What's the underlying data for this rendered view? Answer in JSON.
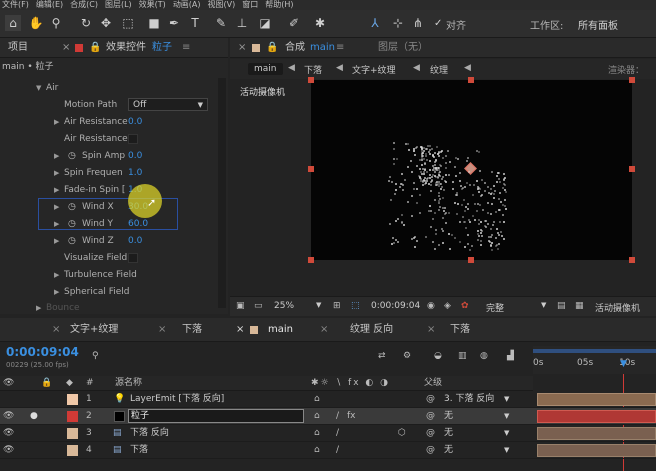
{
  "menu": [
    "文件(F)",
    "编辑(E)",
    "合成(C)",
    "图层(L)",
    "效果(T)",
    "动画(A)",
    "视图(V)",
    "窗口",
    "帮助(H)"
  ],
  "toolbar": {
    "align_label": "对齐",
    "workspace_label": "工作区:",
    "workspace_value": "所有面板"
  },
  "left_panel": {
    "tab_project": "项目",
    "tab_effects": "效果控件",
    "tab_effects_layer": "粒子",
    "breadcrumb": "main • 粒子",
    "air_group": "Air",
    "motion_path_label": "Motion Path",
    "motion_path_value": "Off",
    "props": [
      {
        "label": "Air Resistance",
        "value": "0.0"
      },
      {
        "label": "Air Resistance",
        "value": ""
      },
      {
        "label": "Spin Amp",
        "value": "0.0"
      },
      {
        "label": "Spin Frequen",
        "value": "1.0"
      },
      {
        "label": "Fade-in Spin [",
        "value": "1.0"
      },
      {
        "label": "Wind X",
        "value": "30.0"
      },
      {
        "label": "Wind Y",
        "value": "60.0"
      },
      {
        "label": "Wind Z",
        "value": "0.0"
      },
      {
        "label": "Visualize Field",
        "value": ""
      },
      {
        "label": "Turbulence Field",
        "value": ""
      },
      {
        "label": "Spherical Field",
        "value": ""
      },
      {
        "label": "Bounce",
        "value": ""
      }
    ]
  },
  "viewer": {
    "tab_comp_prefix": "合成",
    "tab_comp_name": "main",
    "tab_layer": "图层（无）",
    "flow": [
      "main",
      "下落",
      "文字+纹理",
      "纹理"
    ],
    "renderer_label": "渲染器：",
    "camera_label": "活动摄像机",
    "zoom": "25%",
    "timecode": "0:00:09:04",
    "quality": "完整",
    "camera_select": "活动摄像机"
  },
  "timeline": {
    "tabs": [
      "文字+纹理",
      "下落",
      "main",
      "纹理 反向",
      "下落"
    ],
    "timecode": "0:00:09:04",
    "frame_info": "00229 (25.00 fps)",
    "col_source": "源名称",
    "col_parent": "父级",
    "col_num": "#",
    "ruler": [
      "0s",
      "05s",
      "10s"
    ],
    "layers": [
      {
        "num": "1",
        "name": "LayerEmit [下落 反向]",
        "parent": "3. 下落 反向",
        "color": "#f0c8a8"
      },
      {
        "num": "2",
        "name": "粒子",
        "parent": "无",
        "color": "#d03a36"
      },
      {
        "num": "3",
        "name": "下落 反向",
        "parent": "无",
        "color": "#d8b898"
      },
      {
        "num": "4",
        "name": "下落",
        "parent": "无",
        "color": "#d8b898"
      }
    ]
  },
  "colors": {
    "accent": "#3a8fe0",
    "selection": "#2a4fa0",
    "track_red": "#b03834",
    "track_tan": "#8a6a50"
  }
}
